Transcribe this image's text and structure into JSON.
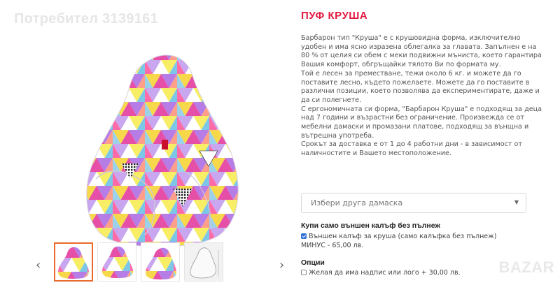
{
  "watermark": "Потребител 3139161",
  "product": {
    "title": "ПУФ КРУША",
    "description": [
      "Барбарон тип \"Круша\" е с крушовидна форма, изключително удобен и има ясно изразена облегалка за главата. Запълнен е на 80 % от целия си обем с меки подвижни мъниста, което гарантира Вашия комфорт, обгръщайки тялото Ви по формата му.",
      "Той е лесен за преместване, тежи около 6 кг. и можете да го поставите лесно, където пожелаете. Можете да го поставите в различни позиции, което позволява да експериментирате, даже и да си полегнете.",
      "С ергономичната си форма, \"Барбарон Круша\" е подходящ за деца над 7 години и възрастни без ограничение. Произвежда се от мебелни дамаски и промазани платове, подходящ за вънщна и вътрешна употреба.",
      "Срокът за доставка е от 1 до 4 работни дни - в зависимост от наличностите и Вашето местоположение."
    ]
  },
  "fabric_select": {
    "placeholder": "Избери друга дамаска"
  },
  "outer_cover": {
    "heading": "Купи само външен калъф без пълнеж",
    "option_label": "Външен калъф за круша (само калъфка без пълнеж) МИНУС - 65,00 лв.",
    "checked": true
  },
  "options": {
    "heading": "Опции",
    "option_label": "Желая да има надпис или лого + 30,00 лв.",
    "checked": false
  },
  "gallery": {
    "prev_arrow": "‹",
    "next_arrow": "›",
    "active_index": 0
  },
  "brand_watermark": "BAZAR",
  "colors": {
    "title": "#e3173e",
    "active_thumb": "#e96a2a",
    "checkbox": "#2f6fd6"
  }
}
